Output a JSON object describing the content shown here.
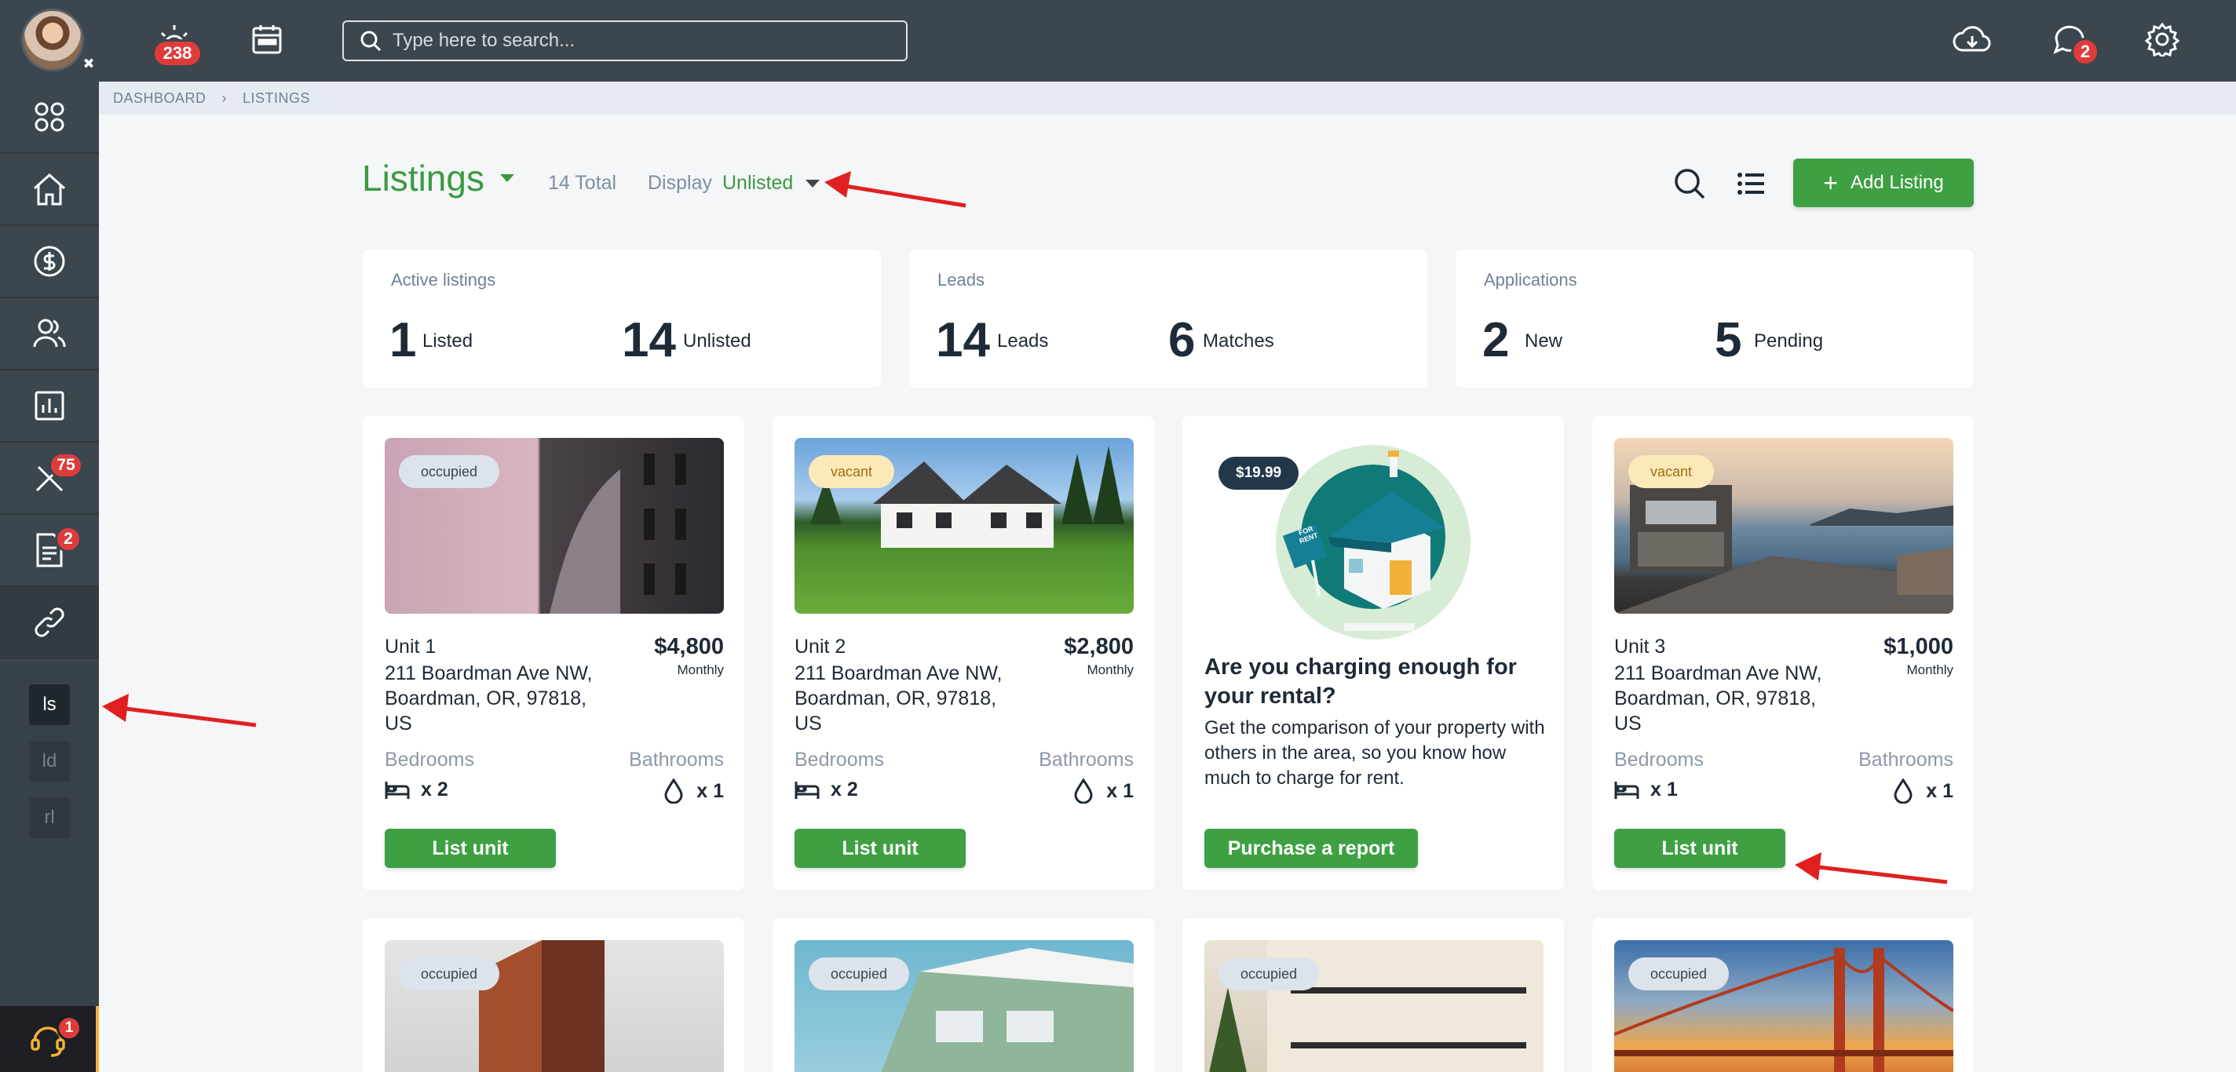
{
  "topbar": {
    "notifications_count": "238",
    "chat_count": "2",
    "search_placeholder": "Type here to search..."
  },
  "sidebar": {
    "maintenance_badge": "75",
    "documents_badge": "2",
    "support_badge": "1",
    "sub_items": [
      "ls",
      "ld",
      "rl"
    ]
  },
  "breadcrumb": [
    "DASHBOARD",
    "LISTINGS"
  ],
  "header": {
    "title": "Listings",
    "total": "14 Total",
    "display_label": "Display",
    "display_value": "Unlisted",
    "add_button": "Add Listing"
  },
  "stats": [
    {
      "label": "Active listings",
      "a_num": "1",
      "a_unit": "Listed",
      "b_num": "14",
      "b_unit": "Unlisted"
    },
    {
      "label": "Leads",
      "a_num": "14",
      "a_unit": "Leads",
      "b_num": "6",
      "b_unit": "Matches"
    },
    {
      "label": "Applications",
      "a_num": "2",
      "a_unit": "New",
      "b_num": "5",
      "b_unit": "Pending"
    }
  ],
  "cards": [
    {
      "status": "occupied",
      "name": "Unit 1",
      "address": "211 Boardman Ave NW, Boardman, OR, 97818, US",
      "price": "$4,800",
      "period": "Monthly",
      "bedrooms_label": "Bedrooms",
      "bathrooms_label": "Bathrooms",
      "beds": "x 2",
      "baths": "x 1",
      "button": "List unit"
    },
    {
      "status": "vacant",
      "name": "Unit 2",
      "address": "211 Boardman Ave NW, Boardman, OR, 97818, US",
      "price": "$2,800",
      "period": "Monthly",
      "bedrooms_label": "Bedrooms",
      "bathrooms_label": "Bathrooms",
      "beds": "x 2",
      "baths": "x 1",
      "button": "List unit"
    },
    {
      "status": "vacant",
      "name": "Unit 3",
      "address": "211 Boardman Ave NW, Boardman, OR, 97818, US",
      "price": "$1,000",
      "period": "Monthly",
      "bedrooms_label": "Bedrooms",
      "bathrooms_label": "Bathrooms",
      "beds": "x 1",
      "baths": "x 1",
      "button": "List unit"
    }
  ],
  "promo": {
    "price": "$19.99",
    "sign": "FOR RENT",
    "title": "Are you charging enough for your rental?",
    "text": "Get the comparison of your property with others in the area, so you know how much to charge for rent.",
    "button": "Purchase a report"
  },
  "lower_cards": [
    "occupied",
    "occupied",
    "occupied",
    "occupied"
  ],
  "colors": {
    "accent": "#3ea043",
    "topbar": "#3b464e",
    "badge": "#e03b3b",
    "annotation_arrow": "#e02020"
  }
}
